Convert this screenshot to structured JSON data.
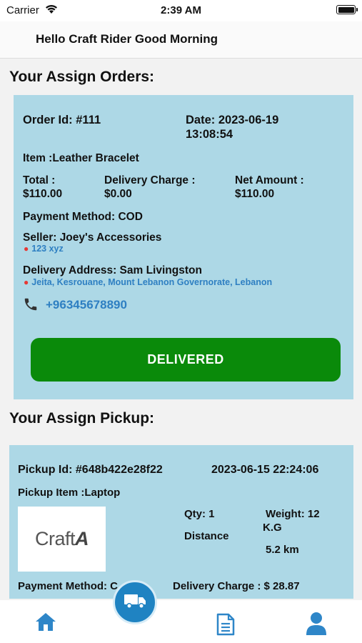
{
  "status_bar": {
    "carrier": "Carrier",
    "time": "2:39 AM"
  },
  "header": {
    "greeting": "Hello Craft Rider Good Morning"
  },
  "orders_section": {
    "title": "Your Assign Orders:"
  },
  "order": {
    "order_id": "Order Id: #111",
    "date_line1": "Date: 2023-06-19",
    "date_line2": "13:08:54",
    "item": "Item :Leather Bracelet",
    "total_label": "Total :",
    "total_value": "$110.00",
    "delivery_charge_label": "Delivery Charge :",
    "delivery_charge_value": "$0.00",
    "net_amount_label": "Net Amount :",
    "net_amount_value": "$110.00",
    "payment_method": "Payment Method: COD",
    "seller": "Seller: Joey's Accessories",
    "seller_address": "123 xyz",
    "delivery_address": "Delivery Address: Sam Livingston",
    "delivery_location": "Jeita, Kesrouane, Mount Lebanon Governorate, Lebanon",
    "phone": "+96345678890",
    "status_button": "DELIVERED"
  },
  "pickup_section": {
    "title": "Your Assign Pickup:"
  },
  "pickup": {
    "pickup_id": "Pickup Id: #648b422e28f22",
    "datetime": "2023-06-15 22:24:06",
    "item": "Pickup Item :Laptop",
    "logo_text": "Craft",
    "qty": "Qty: 1",
    "weight_line1": "Weight: 12",
    "weight_line2": "K.G",
    "distance_label": "Distance",
    "distance_value": "5.2 km",
    "payment_method": "Payment Method: C",
    "delivery_charge": "Delivery Charge :  $ 28.87"
  },
  "tab_bar": {
    "items": [
      {
        "icon": "home-icon"
      },
      {
        "icon": "truck-icon"
      },
      {
        "icon": "document-icon"
      },
      {
        "icon": "user-icon"
      }
    ]
  },
  "colors": {
    "card_bg": "#add8e6",
    "accent_blue": "#2e7fc2",
    "delivered_green": "#0a8a0a",
    "pin_red": "#e53935"
  }
}
